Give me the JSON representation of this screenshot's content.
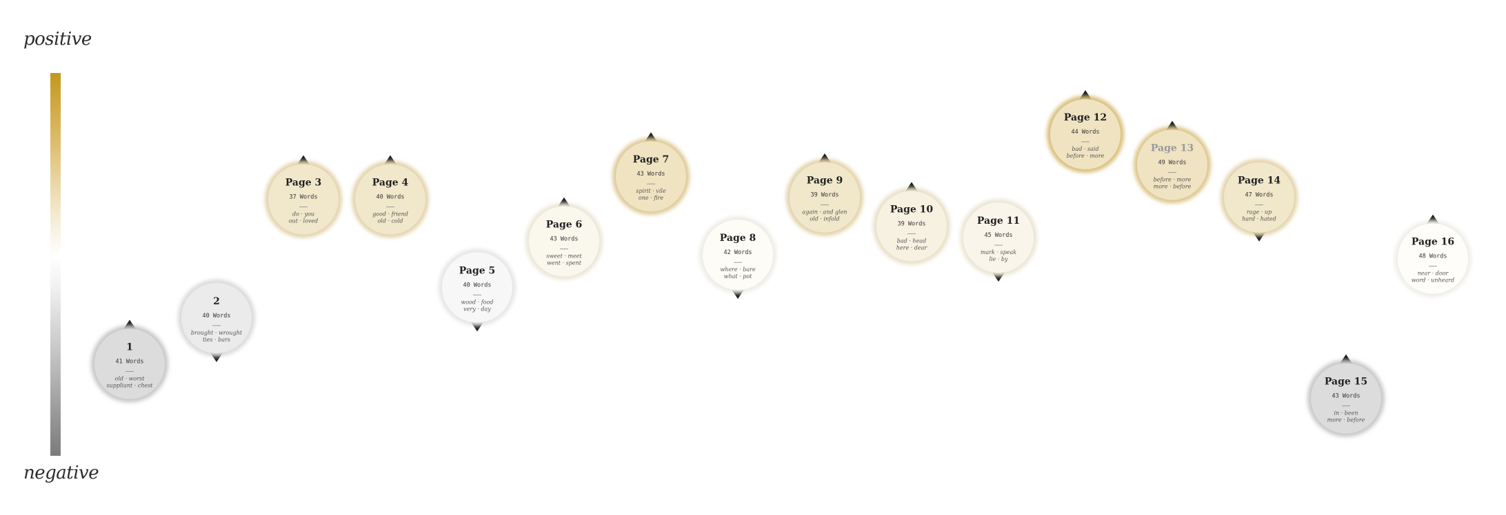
{
  "axis": {
    "top_label": "positive",
    "bottom_label": "negative"
  },
  "chart_data": {
    "type": "scatter",
    "y_label_top": "positive",
    "y_label_bottom": "negative",
    "ylim": [
      -1,
      1
    ],
    "points": [
      {
        "label": "1",
        "words": "41 Words",
        "keywords": [
          "old · worst",
          "suppliant · chest"
        ],
        "sentiment": -0.52
      },
      {
        "label": "2",
        "words": "40 Words",
        "keywords": [
          "brought · wrought",
          "ties · bars"
        ],
        "sentiment": -0.28
      },
      {
        "label": "Page 3",
        "words": "37 Words",
        "keywords": [
          "do · you",
          "out · loved"
        ],
        "sentiment": 0.34
      },
      {
        "label": "Page 4",
        "words": "40 Words",
        "keywords": [
          "good · friend",
          "old · cold"
        ],
        "sentiment": 0.34
      },
      {
        "label": "Page 5",
        "words": "40 Words",
        "keywords": [
          "wood · food",
          "very · day"
        ],
        "sentiment": -0.12
      },
      {
        "label": "Page 6",
        "words": "43 Words",
        "keywords": [
          "sweet · meet",
          "went · spent"
        ],
        "sentiment": 0.12
      },
      {
        "label": "Page 7",
        "words": "43 Words",
        "keywords": [
          "spirit · vile",
          "one · fire"
        ],
        "sentiment": 0.46
      },
      {
        "label": "Page 8",
        "words": "42 Words",
        "keywords": [
          "where · bare",
          "what · pot"
        ],
        "sentiment": 0.05
      },
      {
        "label": "Page 9",
        "words": "39 Words",
        "keywords": [
          "again · and glen",
          "old · infold"
        ],
        "sentiment": 0.35
      },
      {
        "label": "Page 10",
        "words": "39 Words",
        "keywords": [
          "bad · head",
          "here · dear"
        ],
        "sentiment": 0.2
      },
      {
        "label": "Page 11",
        "words": "45 Words",
        "keywords": [
          "mark · speak",
          "lie · by"
        ],
        "sentiment": 0.14
      },
      {
        "label": "Page 12",
        "words": "44 Words",
        "keywords": [
          "bad · said",
          "before · more"
        ],
        "sentiment": 0.68
      },
      {
        "label": "Page 13",
        "words": "49 Words",
        "keywords": [
          "before · more",
          "more · before"
        ],
        "sentiment": 0.52
      },
      {
        "label": "Page 14",
        "words": "47 Words",
        "keywords": [
          "rage · up",
          "hard · hated"
        ],
        "sentiment": 0.35
      },
      {
        "label": "Page 15",
        "words": "43 Words",
        "keywords": [
          "in · been",
          "more · before"
        ],
        "sentiment": -0.7
      },
      {
        "label": "Page 16",
        "words": "48 Words",
        "keywords": [
          "near · door",
          "word · unheard"
        ],
        "sentiment": 0.03
      }
    ]
  },
  "colors": {
    "positive": "#c4971e",
    "neutral": "#ffffff",
    "negative": "#7b7b7b"
  }
}
